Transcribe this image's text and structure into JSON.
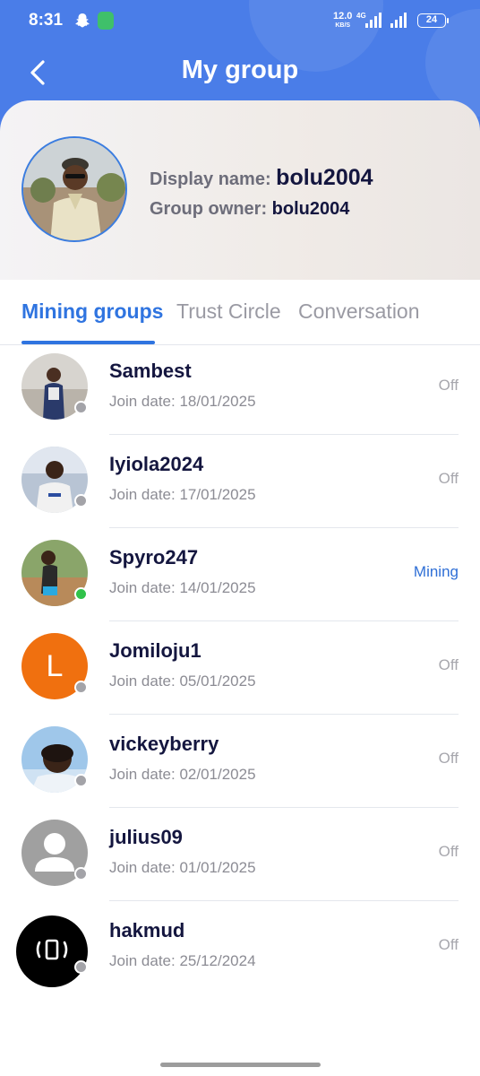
{
  "status_bar": {
    "time": "8:31",
    "speed_value": "12.0",
    "speed_unit": "KB/S",
    "network": "4G",
    "battery": "24"
  },
  "header": {
    "title": "My group",
    "back_icon": "chevron-left-icon"
  },
  "profile": {
    "display_name_label": "Display name:",
    "display_name": "bolu2004",
    "group_owner_label": "Group owner:",
    "group_owner": "bolu2004"
  },
  "tabs": [
    {
      "label": "Mining groups",
      "active": true
    },
    {
      "label": "Trust Circle",
      "active": false
    },
    {
      "label": "Conversation",
      "active": false
    }
  ],
  "members": [
    {
      "name": "Sambest",
      "join_date": "Join date: 18/01/2025",
      "status": "Off",
      "online": false
    },
    {
      "name": "Iyiola2024",
      "join_date": "Join date: 17/01/2025",
      "status": "Off",
      "online": false
    },
    {
      "name": "Spyro247",
      "join_date": "Join date: 14/01/2025",
      "status": "Mining",
      "online": true
    },
    {
      "name": "Jomiloju1",
      "join_date": "Join date: 05/01/2025",
      "status": "Off",
      "online": false,
      "avatar_letter": "L"
    },
    {
      "name": "vickeyberry",
      "join_date": "Join date: 02/01/2025",
      "status": "Off",
      "online": false
    },
    {
      "name": "julius09",
      "join_date": "Join date: 01/01/2025",
      "status": "Off",
      "online": false
    },
    {
      "name": "hakmud",
      "join_date": "Join date: 25/12/2024",
      "status": "Off",
      "online": false
    }
  ],
  "colors": {
    "header_blue": "#4a7de8",
    "accent": "#2f74e0",
    "online_green": "#30c24a",
    "offline_gray": "#a3a3a8",
    "name_navy": "#14163f"
  }
}
